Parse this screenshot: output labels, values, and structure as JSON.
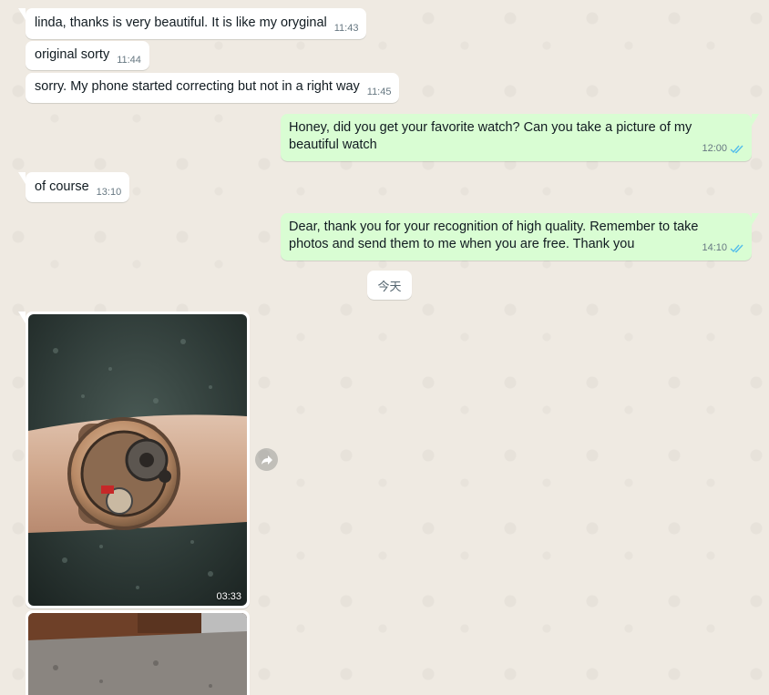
{
  "messages": [
    {
      "dir": "in",
      "text": "linda, thanks is very beautiful. It is like my oryginal",
      "time": "11:43"
    },
    {
      "dir": "in",
      "text": "original sorty",
      "time": "11:44"
    },
    {
      "dir": "in",
      "text": "sorry. My phone started correcting but not in a right way",
      "time": "11:45"
    },
    {
      "dir": "out",
      "text": "Honey, did you get your favorite watch? Can you take a picture of my beautiful watch",
      "time": "12:00",
      "status": "read"
    },
    {
      "dir": "in",
      "text": "of course",
      "time": "13:10"
    },
    {
      "dir": "out",
      "text": "Dear, thank you for your recognition of high quality. Remember to take photos and send them to me when you are free. Thank you",
      "time": "14:10",
      "status": "read"
    }
  ],
  "date_divider": "今天",
  "image_messages": [
    {
      "dir": "in",
      "time": "03:33",
      "depicts": "watch-on-wrist-photo"
    },
    {
      "dir": "in",
      "time": "",
      "depicts": "kitchen-counter-photo"
    }
  ],
  "colors": {
    "background": "#efeae2",
    "incoming_bubble": "#ffffff",
    "outgoing_bubble": "#d9fdd3",
    "read_ticks": "#53bdeb",
    "time_text": "#667781"
  }
}
